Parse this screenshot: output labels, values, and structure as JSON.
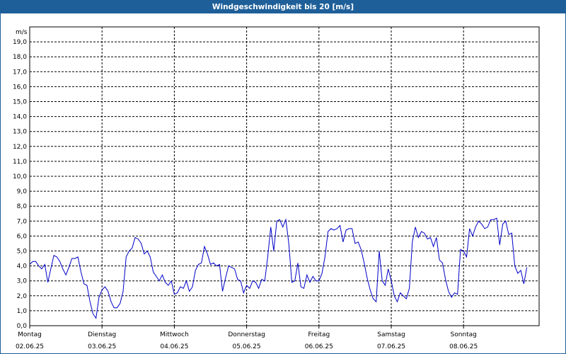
{
  "chart_data": {
    "type": "line",
    "title": "Windgeschwindigkeit bis 20 [m/s]",
    "unit": "m/s",
    "ylim": [
      0,
      20
    ],
    "grid": true,
    "y_ticks": [
      "0,0",
      "1,0",
      "2,0",
      "3,0",
      "4,0",
      "5,0",
      "6,0",
      "7,0",
      "8,0",
      "9,0",
      "10,0",
      "11,0",
      "12,0",
      "13,0",
      "14,0",
      "15,0",
      "16,0",
      "17,0",
      "18,0",
      "19,0"
    ],
    "x_ticks": [
      {
        "day": "Montag",
        "date": "02.06.25"
      },
      {
        "day": "Dienstag",
        "date": "03.06.25"
      },
      {
        "day": "Mittwoch",
        "date": "04.06.25"
      },
      {
        "day": "Donnerstag",
        "date": "05.06.25"
      },
      {
        "day": "Freitag",
        "date": "06.06.25"
      },
      {
        "day": "Samstag",
        "date": "07.06.25"
      },
      {
        "day": "Sonntag",
        "date": "08.06.25"
      }
    ],
    "colors": {
      "line": "#0000c8",
      "titlebar": "#1e5f99",
      "axes": "#000000"
    },
    "series": [
      {
        "x_start_date": "02.06.25",
        "step_hours": 1,
        "values": [
          4.1,
          4.3,
          4.3,
          4.0,
          3.8,
          4.1,
          2.9,
          3.8,
          4.7,
          4.6,
          4.3,
          3.8,
          3.4,
          3.9,
          4.5,
          4.5,
          4.6,
          3.6,
          2.8,
          2.7,
          1.6,
          0.8,
          0.5,
          1.9,
          2.4,
          2.6,
          2.3,
          1.6,
          1.2,
          1.2,
          1.5,
          2.3,
          4.6,
          5.0,
          5.2,
          5.9,
          5.8,
          5.5,
          4.8,
          5.0,
          4.6,
          3.6,
          3.3,
          3.0,
          3.4,
          2.9,
          2.7,
          3.0,
          2.1,
          2.2,
          2.6,
          2.5,
          3.0,
          2.3,
          2.6,
          3.7,
          4.1,
          4.2,
          5.3,
          4.8,
          4.1,
          4.2,
          4.0,
          4.1,
          2.3,
          3.2,
          4.0,
          3.9,
          3.8,
          3.1,
          3.0,
          2.2,
          2.7,
          2.5,
          3.0,
          2.9,
          2.5,
          3.1,
          3.0,
          4.6,
          6.6,
          5.0,
          7.0,
          7.1,
          6.6,
          7.1,
          5.5,
          2.9,
          3.0,
          4.2,
          2.6,
          2.5,
          3.4,
          2.9,
          3.3,
          3.0,
          3.0,
          3.5,
          4.6,
          6.3,
          6.5,
          6.4,
          6.5,
          6.7,
          5.6,
          6.4,
          6.5,
          6.5,
          5.5,
          5.6,
          5.1,
          4.2,
          3.2,
          2.4,
          1.8,
          1.6,
          5.0,
          3.0,
          2.7,
          3.8,
          3.0,
          2.0,
          1.6,
          2.2,
          2.0,
          1.8,
          2.5,
          5.6,
          6.6,
          5.9,
          6.3,
          6.2,
          5.8,
          5.9,
          5.3,
          5.9,
          4.4,
          4.2,
          3.1,
          2.3,
          1.9,
          2.2,
          2.1,
          5.1,
          5.0,
          4.6,
          6.5,
          6.0,
          6.6,
          7.0,
          6.8,
          6.5,
          6.6,
          7.1,
          7.1,
          7.2,
          5.4,
          6.8,
          7.0,
          6.1,
          6.2,
          4.0,
          3.5,
          3.7,
          2.8,
          3.9
        ]
      }
    ]
  }
}
